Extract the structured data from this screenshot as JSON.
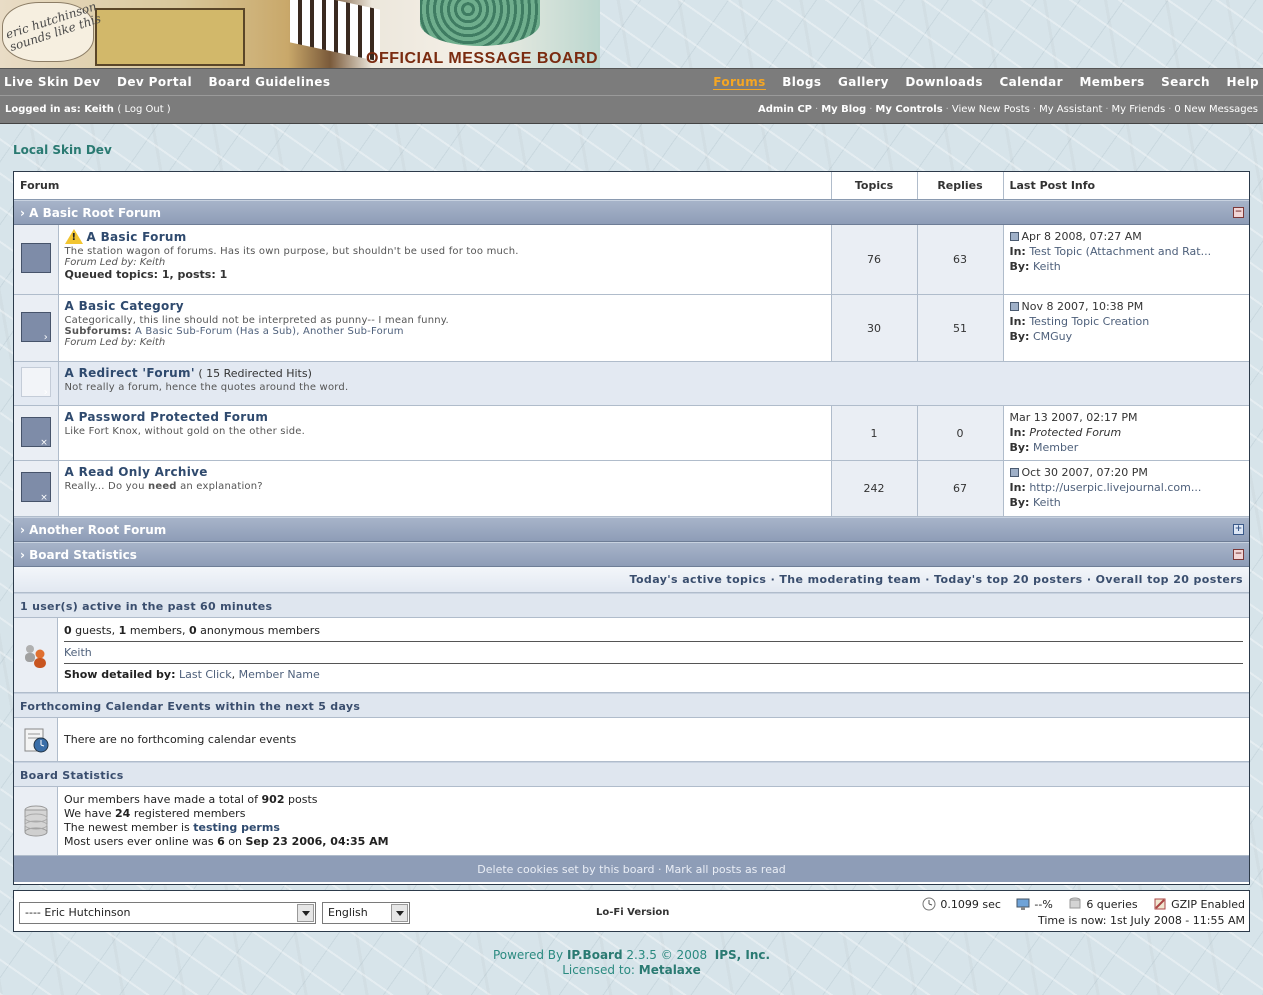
{
  "banner": {
    "title": "OFFICIAL MESSAGE BOARD",
    "scribble_line1": "eric hutchinson",
    "scribble_line2": "sounds like this"
  },
  "nav": {
    "left_links": [
      "Live Skin Dev",
      "Dev Portal",
      "Board Guidelines"
    ],
    "right_links": [
      "Forums",
      "Blogs",
      "Gallery",
      "Downloads",
      "Calendar",
      "Members",
      "Search",
      "Help"
    ],
    "active_link": "Forums",
    "logged_in_label": "Logged in as:",
    "username": "Keith",
    "logout": "( Log Out )",
    "user_links_bold": [
      "Admin CP",
      "My Blog",
      "My Controls"
    ],
    "user_links": [
      "View New Posts",
      "My Assistant",
      "My Friends",
      "0 New Messages"
    ]
  },
  "breadcrumb": "Local Skin Dev",
  "table_headers": {
    "forum": "Forum",
    "topics": "Topics",
    "replies": "Replies",
    "last_post": "Last Post Info"
  },
  "categories": {
    "root1": "A Basic Root Forum",
    "root2": "Another Root Forum",
    "stats": "Board Statistics"
  },
  "forums": [
    {
      "name": "A Basic Forum",
      "desc": "The station wagon of forums. Has its own purpose, but shouldn't be used for too much.",
      "led": "Forum Led by: Keith",
      "queued": "Queued topics: 1, posts: 1",
      "topics": "76",
      "replies": "63",
      "last_date": "Apr 8 2008, 07:27 AM",
      "in_label": "In:",
      "last_in": "Test Topic (Attachment and Rat...",
      "by_label": "By:",
      "last_by": "Keith"
    },
    {
      "name": "A Basic Category",
      "desc": "Categorically, this line should not be interpreted as punny-- I mean funny.",
      "subforums_label": "Subforums:",
      "subforums": "A Basic Sub-Forum (Has a Sub), Another Sub-Forum",
      "led": "Forum Led by: Keith",
      "topics": "30",
      "replies": "51",
      "last_date": "Nov 8 2007, 10:38 PM",
      "in_label": "In:",
      "last_in": "Testing Topic Creation",
      "by_label": "By:",
      "last_by": "CMGuy"
    },
    {
      "name": "A Redirect 'Forum'",
      "hits": "( 15 Redirected Hits)",
      "desc": "Not really a forum, hence the quotes around the word."
    },
    {
      "name": "A Password Protected Forum",
      "desc": "Like Fort Knox, without gold on the other side.",
      "topics": "1",
      "replies": "0",
      "last_date": "Mar 13 2007, 02:17 PM",
      "in_label": "In:",
      "last_in": "Protected Forum",
      "by_label": "By:",
      "last_by": "Member"
    },
    {
      "name": "A Read Only Archive",
      "desc_a": "Really... Do you",
      "desc_b": "need",
      "desc_c": "an explanation?",
      "topics": "242",
      "replies": "67",
      "last_date": "Oct 30 2007, 07:20 PM",
      "in_label": "In:",
      "last_in": "http://userpic.livejournal.com...",
      "by_label": "By:",
      "last_by": "Keith"
    }
  ],
  "stats_links": "Today's active topics · The moderating team · Today's top 20 posters · Overall top 20 posters",
  "active_users": {
    "heading": "1 user(s) active in the past 60 minutes",
    "guests_n": "0",
    "guests": "guests,",
    "members_n": "1",
    "members": "members,",
    "anon_n": "0",
    "anon": "anonymous members",
    "user": "Keith",
    "detail_label": "Show detailed by:",
    "detail_a": "Last Click",
    "detail_b": "Member Name"
  },
  "calendar": {
    "heading": "Forthcoming Calendar Events within the next 5 days",
    "text": "There are no forthcoming calendar events"
  },
  "board_stats": {
    "heading": "Board Statistics",
    "posts_a": "Our members have made a total of",
    "posts_n": "902",
    "posts_b": "posts",
    "members_a": "We have",
    "members_n": "24",
    "members_b": "registered members",
    "newest_a": "The newest member is",
    "newest": "testing perms",
    "online_a": "Most users ever online was",
    "online_n": "6",
    "online_b": "on",
    "online_date": "Sep 23 2006, 04:35 AM"
  },
  "footer_bar": "Delete cookies set by this board · Mark all posts as read",
  "bottom": {
    "skin_select": "---- Eric Hutchinson",
    "lang_select": "English",
    "lofi": "Lo-Fi Version",
    "time": "0.1099 sec",
    "load": "--%",
    "queries": "6 queries",
    "gzip": "GZIP Enabled",
    "time_now": "Time is now: 1st July 2008 - 11:55 AM"
  },
  "powered": {
    "prefix": "Powered By",
    "product": "IP.Board",
    "version": "2.3.5 © 2008",
    "company": "IPS, Inc.",
    "licensed": "Licensed to:",
    "licensee": "Metalaxe"
  }
}
